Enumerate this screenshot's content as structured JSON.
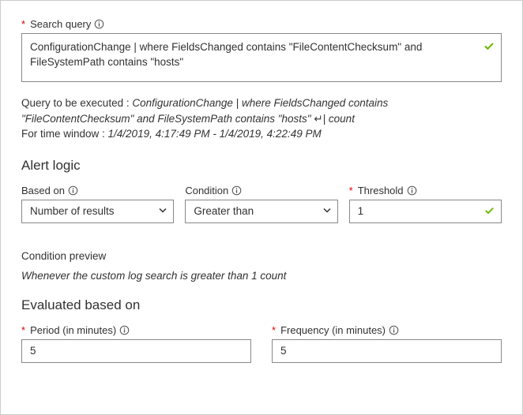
{
  "searchQuery": {
    "label": "Search query",
    "value": "ConfigurationChange | where FieldsChanged contains \"FileContentChecksum\" and FileSystemPath contains \"hosts\""
  },
  "queryPreview": {
    "prefix": "Query to be executed : ",
    "queryText": "ConfigurationChange | where FieldsChanged contains \"FileContentChecksum\" and FileSystemPath contains \"hosts\" ",
    "countSuffix": "| count",
    "timePrefix": "For time window : ",
    "timeValue": "1/4/2019, 4:17:49 PM - 1/4/2019, 4:22:49 PM"
  },
  "alertLogic": {
    "heading": "Alert logic",
    "basedOn": {
      "label": "Based on",
      "value": "Number of results"
    },
    "condition": {
      "label": "Condition",
      "value": "Greater than"
    },
    "threshold": {
      "label": "Threshold",
      "value": "1"
    }
  },
  "conditionPreview": {
    "label": "Condition preview",
    "text": "Whenever the custom log search is greater than 1 count"
  },
  "evaluated": {
    "heading": "Evaluated based on",
    "period": {
      "label": "Period (in minutes)",
      "value": "5"
    },
    "frequency": {
      "label": "Frequency (in minutes)",
      "value": "5"
    }
  }
}
